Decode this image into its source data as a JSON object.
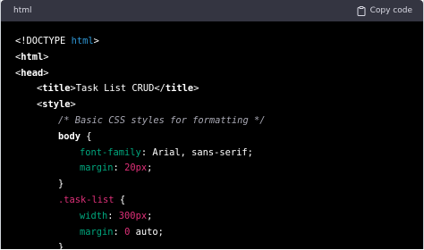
{
  "header": {
    "language": "html",
    "copy_label": "Copy code"
  },
  "code_lines": [
    {
      "indent": 0,
      "tokens": [
        {
          "t": "<!DOCTYPE ",
          "c": "tok-doctype-a"
        },
        {
          "t": "html",
          "c": "tok-doctype-b"
        },
        {
          "t": ">",
          "c": "tok-doctype-a"
        }
      ]
    },
    {
      "indent": 0,
      "tokens": [
        {
          "t": "<",
          "c": "tok-punct"
        },
        {
          "t": "html",
          "c": "tok-tag-white bold"
        },
        {
          "t": ">",
          "c": "tok-punct"
        }
      ]
    },
    {
      "indent": 0,
      "tokens": [
        {
          "t": "<",
          "c": "tok-punct"
        },
        {
          "t": "head",
          "c": "tok-tag-white bold"
        },
        {
          "t": ">",
          "c": "tok-punct"
        }
      ]
    },
    {
      "indent": 1,
      "tokens": [
        {
          "t": "<",
          "c": "tok-punct"
        },
        {
          "t": "title",
          "c": "tok-tag-white bold"
        },
        {
          "t": ">Task List CRUD</",
          "c": "tok-val"
        },
        {
          "t": "title",
          "c": "tok-tag-white bold"
        },
        {
          "t": ">",
          "c": "tok-punct"
        }
      ]
    },
    {
      "indent": 1,
      "tokens": [
        {
          "t": "<",
          "c": "tok-punct"
        },
        {
          "t": "style",
          "c": "tok-tag-white bold"
        },
        {
          "t": ">",
          "c": "tok-punct"
        }
      ]
    },
    {
      "indent": 2,
      "tokens": [
        {
          "t": "/* Basic CSS styles for formatting */",
          "c": "tok-comment"
        }
      ]
    },
    {
      "indent": 2,
      "tokens": [
        {
          "t": "body",
          "c": "tok-selector bold"
        },
        {
          "t": " {",
          "c": "tok-punct"
        }
      ]
    },
    {
      "indent": 3,
      "tokens": [
        {
          "t": "font-family",
          "c": "tok-prop"
        },
        {
          "t": ": Arial, sans-serif;",
          "c": "tok-val"
        }
      ]
    },
    {
      "indent": 3,
      "tokens": [
        {
          "t": "margin",
          "c": "tok-prop"
        },
        {
          "t": ": ",
          "c": "tok-val"
        },
        {
          "t": "20px",
          "c": "tok-num"
        },
        {
          "t": ";",
          "c": "tok-val"
        }
      ]
    },
    {
      "indent": 2,
      "tokens": [
        {
          "t": "}",
          "c": "tok-punct"
        }
      ]
    },
    {
      "indent": 2,
      "tokens": [
        {
          "t": ".task-list",
          "c": "tok-class"
        },
        {
          "t": " {",
          "c": "tok-punct"
        }
      ]
    },
    {
      "indent": 3,
      "tokens": [
        {
          "t": "width",
          "c": "tok-prop"
        },
        {
          "t": ": ",
          "c": "tok-val"
        },
        {
          "t": "300px",
          "c": "tok-num"
        },
        {
          "t": ";",
          "c": "tok-val"
        }
      ]
    },
    {
      "indent": 3,
      "tokens": [
        {
          "t": "margin",
          "c": "tok-prop"
        },
        {
          "t": ": ",
          "c": "tok-val"
        },
        {
          "t": "0",
          "c": "tok-num"
        },
        {
          "t": " auto;",
          "c": "tok-val"
        }
      ]
    },
    {
      "indent": 2,
      "tokens": [
        {
          "t": "}",
          "c": "tok-punct"
        }
      ]
    }
  ]
}
